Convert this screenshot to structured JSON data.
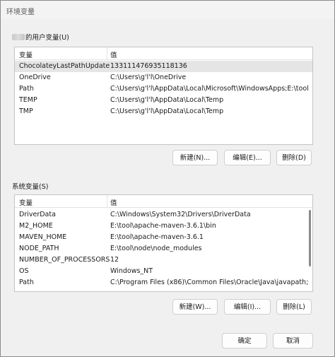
{
  "window": {
    "title": "环境变量"
  },
  "user_vars": {
    "group_label": "的用户变量(U)",
    "columns": [
      "变量",
      "值"
    ],
    "rows": [
      {
        "name": "ChocolateyLastPathUpdate",
        "value": "133111476935118136"
      },
      {
        "name": "OneDrive",
        "value": "C:\\Users\\g'l'l\\OneDrive"
      },
      {
        "name": "Path",
        "value": "C:\\Users\\g'l'l\\AppData\\Local\\Microsoft\\WindowsApps;E:\\tool..."
      },
      {
        "name": "TEMP",
        "value": "C:\\Users\\g'l'l\\AppData\\Local\\Temp"
      },
      {
        "name": "TMP",
        "value": "C:\\Users\\g'l'l\\AppData\\Local\\Temp"
      }
    ],
    "buttons": {
      "new": "新建(N)...",
      "edit": "编辑(E)...",
      "delete": "删除(D)"
    }
  },
  "system_vars": {
    "group_label": "系统变量(S)",
    "columns": [
      "变量",
      "值"
    ],
    "rows": [
      {
        "name": "DriverData",
        "value": "C:\\Windows\\System32\\Drivers\\DriverData"
      },
      {
        "name": "M2_HOME",
        "value": "E:\\tool\\apache-maven-3.6.1\\bin"
      },
      {
        "name": "MAVEN_HOME",
        "value": "E:\\tool\\apache-maven-3.6.1"
      },
      {
        "name": "NODE_PATH",
        "value": "E:\\tool\\node\\node_modules"
      },
      {
        "name": "NUMBER_OF_PROCESSORS",
        "value": "12"
      },
      {
        "name": "OS",
        "value": "Windows_NT"
      },
      {
        "name": "Path",
        "value": "C:\\Program Files (x86)\\Common Files\\Oracle\\Java\\javapath;C:..."
      }
    ],
    "buttons": {
      "new": "新建(W)...",
      "edit": "编辑(I)...",
      "delete": "删除(L)"
    }
  },
  "footer": {
    "ok": "确定",
    "cancel": "取消"
  }
}
